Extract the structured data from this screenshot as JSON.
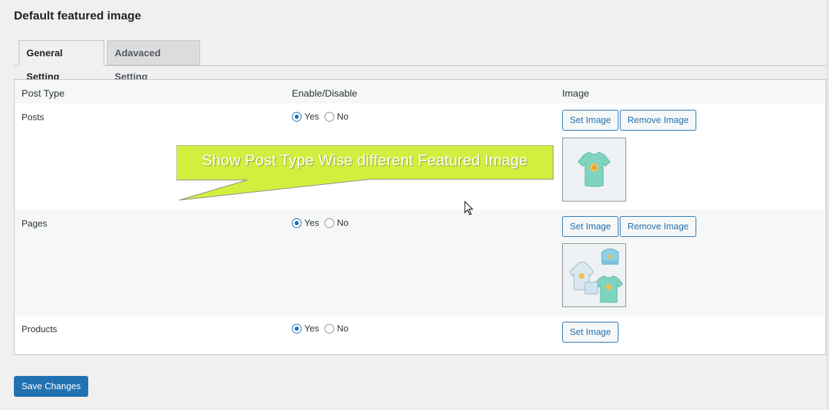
{
  "page": {
    "title": "Default featured image"
  },
  "tabs": [
    {
      "label": "General Setting",
      "active": true
    },
    {
      "label": "Adavaced Setting",
      "active": false
    }
  ],
  "table": {
    "headers": {
      "post_type": "Post Type",
      "enable": "Enable/Disable",
      "image": "Image"
    },
    "rows": [
      {
        "label": "Posts",
        "yes": "Yes",
        "no": "No",
        "selected": "Yes",
        "set_image": "Set Image",
        "remove_image": "Remove Image",
        "has_image": true,
        "thumb": "tshirt"
      },
      {
        "label": "Pages",
        "yes": "Yes",
        "no": "No",
        "selected": "Yes",
        "set_image": "Set Image",
        "remove_image": "Remove Image",
        "has_image": true,
        "thumb": "apparel-set"
      },
      {
        "label": "Products",
        "yes": "Yes",
        "no": "No",
        "selected": "Yes",
        "set_image": "Set Image",
        "has_image": false
      }
    ]
  },
  "callout": {
    "text": "Show Post Type Wise different Featured Image",
    "color": "#d4ee3f"
  },
  "footer": {
    "save_label": "Save Changes"
  },
  "colors": {
    "accent": "#2271b1",
    "background": "#f0f0f1"
  }
}
